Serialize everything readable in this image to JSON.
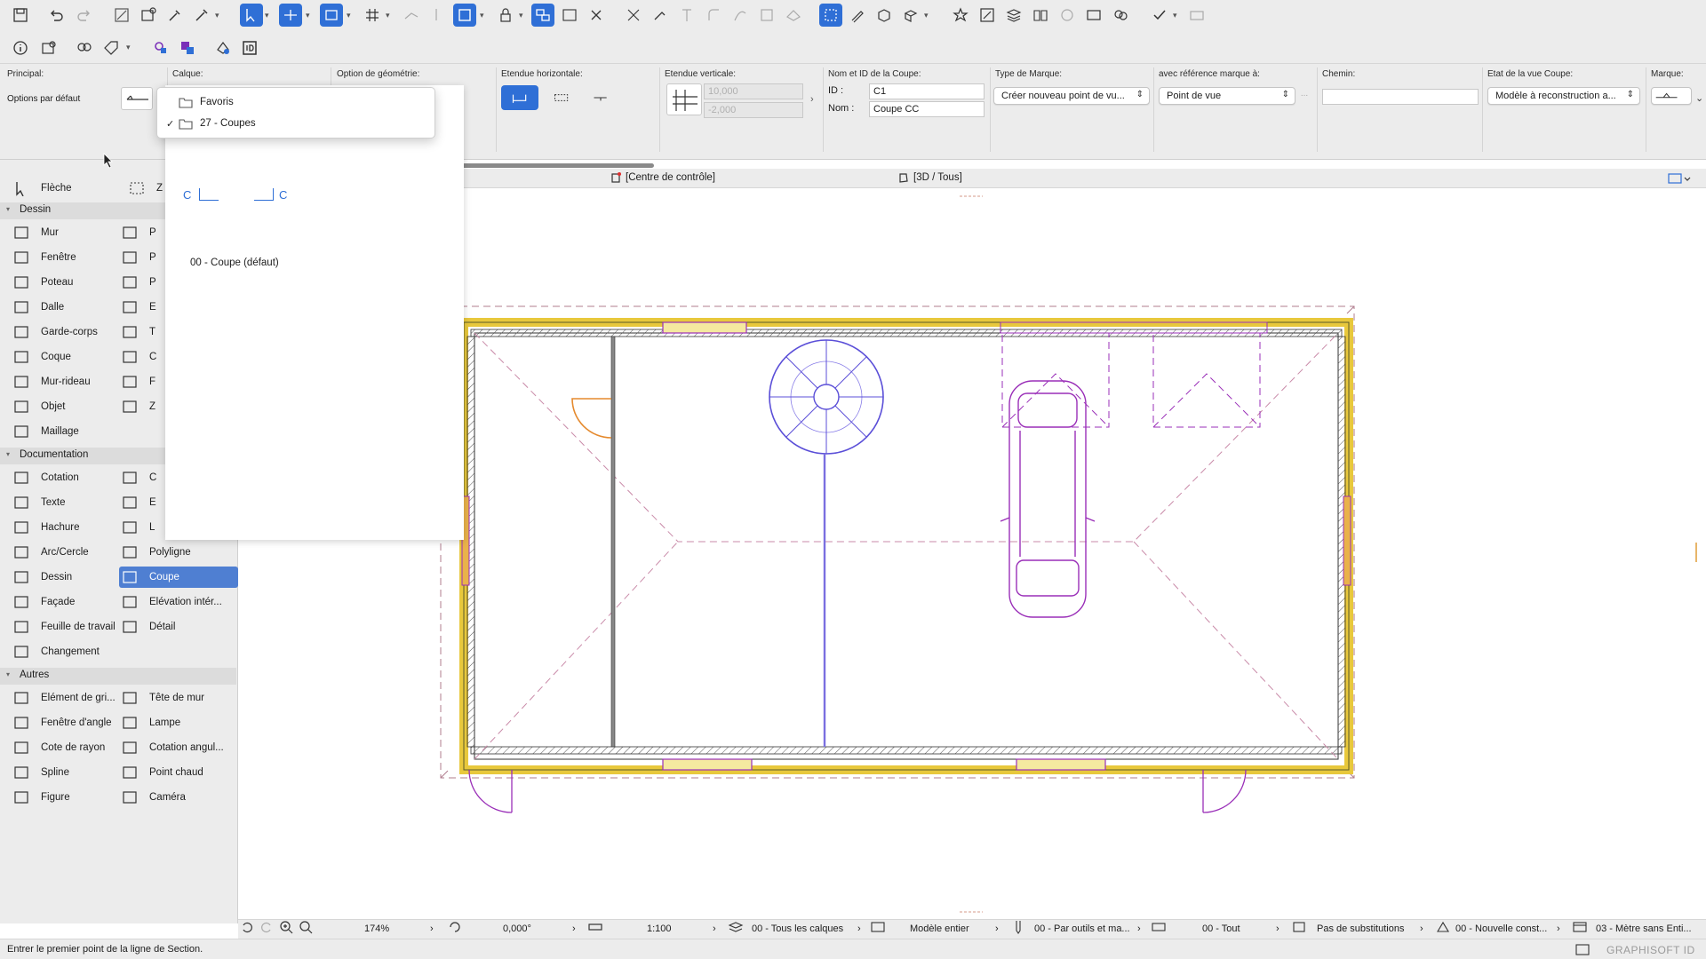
{
  "infobox": {
    "principal": {
      "header": "Principal:",
      "value": "Options par défaut"
    },
    "calque": {
      "header": "Calque:"
    },
    "geometrie": {
      "header": "Option de géométrie:"
    },
    "etendue_h": {
      "header": "Etendue horizontale:"
    },
    "etendue_v": {
      "header": "Etendue verticale:",
      "top_value": "10,000",
      "bottom_value": "-2,000"
    },
    "nom_id": {
      "header": "Nom et ID de la Coupe:",
      "id_label": "ID :",
      "id_value": "C1",
      "nom_label": "Nom :",
      "nom_value": "Coupe CC"
    },
    "type_marque": {
      "header": "Type de Marque:",
      "value": "Créer nouveau point de vu..."
    },
    "reference": {
      "header": "avec référence marque à:",
      "value": "Point de vue",
      "more": "..."
    },
    "chemin": {
      "header": "Chemin:",
      "value": ""
    },
    "etat": {
      "header": "Etat de la vue Coupe:",
      "value": "Modèle à reconstruction a..."
    },
    "marque": {
      "header": "Marque:"
    }
  },
  "layer_menu": {
    "items": [
      {
        "label": "Favoris",
        "checked": false
      },
      {
        "label": "27 - Coupes",
        "checked": true
      }
    ],
    "check": "✓"
  },
  "favorites_panel": {
    "marker_left": "C",
    "marker_right": "C",
    "preset_name": "00 - Coupe (défaut)"
  },
  "toolbox": {
    "top_tools": [
      {
        "label": "Flèche",
        "icon": "arrow-pointer-icon"
      },
      {
        "label": "Z",
        "icon": "marquee-icon"
      }
    ],
    "groups": [
      {
        "name": "Dessin",
        "tools": [
          [
            "Mur",
            "P"
          ],
          [
            "Fenêtre",
            "P"
          ],
          [
            "Poteau",
            "P"
          ],
          [
            "Dalle",
            "E"
          ],
          [
            "Garde-corps",
            "T"
          ],
          [
            "Coque",
            "C"
          ],
          [
            "Mur-rideau",
            "F"
          ],
          [
            "Objet",
            "Z"
          ],
          [
            "Maillage",
            ""
          ]
        ]
      },
      {
        "name": "Documentation",
        "tools": [
          [
            "Cotation",
            "C"
          ],
          [
            "Texte",
            "E"
          ],
          [
            "Hachure",
            "L"
          ],
          [
            "Arc/Cercle",
            "Polyligne"
          ],
          [
            "Dessin",
            "Coupe"
          ],
          [
            "Façade",
            "Elévation intér..."
          ],
          [
            "Feuille de travail",
            "Détail"
          ],
          [
            "Changement",
            ""
          ]
        ]
      },
      {
        "name": "Autres",
        "tools": [
          [
            "Elément de gri...",
            "Tête de mur"
          ],
          [
            "Fenêtre d'angle",
            "Lampe"
          ],
          [
            "Cote de rayon",
            "Cotation angul..."
          ],
          [
            "Spline",
            "Point chaud"
          ],
          [
            "Figure",
            "Caméra"
          ]
        ]
      }
    ],
    "selected": "Coupe"
  },
  "tabs": [
    {
      "label": "[Centre de contrôle]",
      "icon": "control-center-icon"
    },
    {
      "label": "[3D / Tous]",
      "icon": "3d-view-icon"
    }
  ],
  "statusbar": {
    "zoom": "174%",
    "angle": "0,000°",
    "scale": "1:100",
    "layers": "00 - Tous les calques",
    "model": "Modèle entier",
    "pen": "00 - Par outils et ma...",
    "struct": "00 - Tout",
    "override": "Pas de substitutions",
    "renovation": "00 - Nouvelle const...",
    "dimension": "03 - Mètre sans Enti..."
  },
  "footer": {
    "prompt": "Entrer le premier point de la ligne de Section.",
    "brand": "GRAPHISOFT ID"
  },
  "colors": {
    "accent": "#2f6fd6",
    "wall_fill": "#f2dc5d",
    "purple": "#9a2fb8",
    "stair": "#5b4fd8",
    "orange": "#e58a2e",
    "pink_dashed": "#c98aa8"
  }
}
